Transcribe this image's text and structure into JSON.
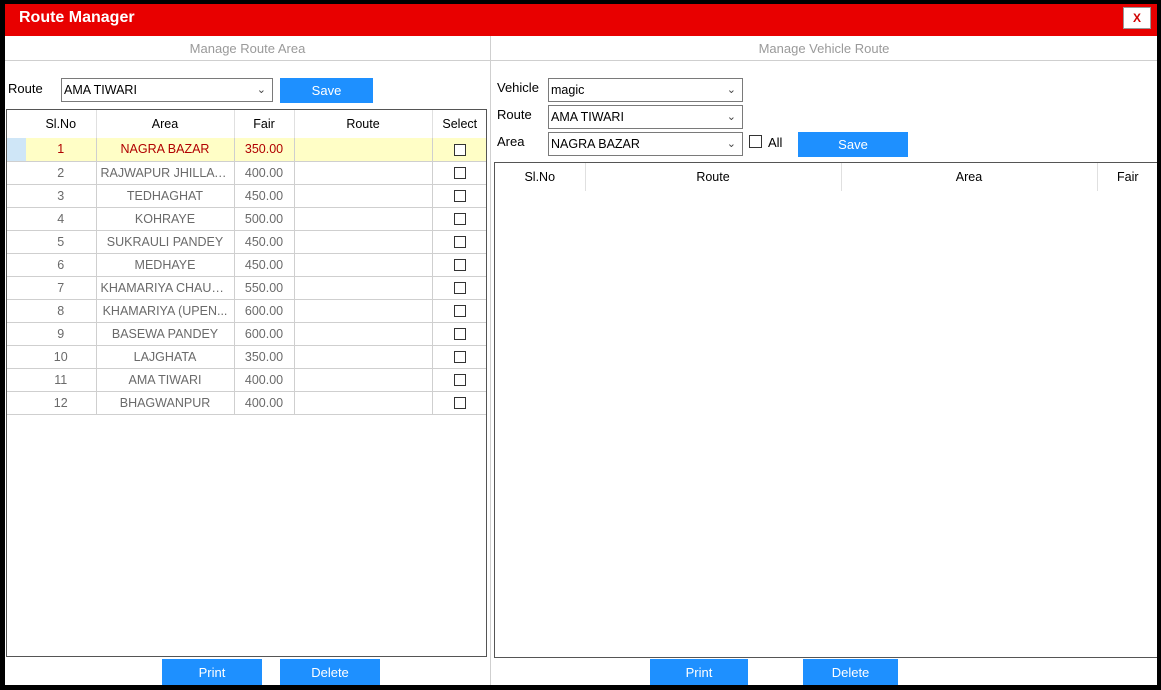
{
  "window": {
    "title": "Route Manager",
    "close_label": "X"
  },
  "left_panel": {
    "header": "Manage Route Area",
    "route_label": "Route",
    "route_value": "AMA TIWARI",
    "save_label": "Save",
    "columns": [
      "Sl.No",
      "Area",
      "Fair",
      "Route",
      "Select"
    ],
    "rows": [
      {
        "sl": "1",
        "area": "NAGRA BAZAR",
        "fair": "350.00",
        "route": ""
      },
      {
        "sl": "2",
        "area": "RAJWAPUR JHILLA C...",
        "fair": "400.00",
        "route": ""
      },
      {
        "sl": "3",
        "area": "TEDHAGHAT",
        "fair": "450.00",
        "route": ""
      },
      {
        "sl": "4",
        "area": "KOHRAYE",
        "fair": "500.00",
        "route": ""
      },
      {
        "sl": "5",
        "area": "SUKRAULI PANDEY",
        "fair": "450.00",
        "route": ""
      },
      {
        "sl": "6",
        "area": "MEDHAYE",
        "fair": "450.00",
        "route": ""
      },
      {
        "sl": "7",
        "area": "KHAMARIYA CHAUR...",
        "fair": "550.00",
        "route": ""
      },
      {
        "sl": "8",
        "area": "KHAMARIYA (UPEN...",
        "fair": "600.00",
        "route": ""
      },
      {
        "sl": "9",
        "area": "BASEWA PANDEY",
        "fair": "600.00",
        "route": ""
      },
      {
        "sl": "10",
        "area": "LAJGHATA",
        "fair": "350.00",
        "route": ""
      },
      {
        "sl": "11",
        "area": "AMA TIWARI",
        "fair": "400.00",
        "route": ""
      },
      {
        "sl": "12",
        "area": "BHAGWANPUR",
        "fair": "400.00",
        "route": ""
      }
    ],
    "print_label": "Print",
    "delete_label": "Delete"
  },
  "right_panel": {
    "header": "Manage Vehicle Route",
    "vehicle_label": "Vehicle",
    "vehicle_value": "magic",
    "route_label": "Route",
    "route_value": "AMA TIWARI",
    "area_label": "Area",
    "area_value": "NAGRA BAZAR",
    "all_label": "All",
    "save_label": "Save",
    "columns": [
      "Sl.No",
      "Route",
      "Area",
      "Fair"
    ],
    "print_label": "Print",
    "delete_label": "Delete"
  },
  "colors": {
    "title_bar": "#e80000",
    "button": "#1e90ff",
    "selected_row_bg": "#fffec6",
    "selected_row_text": "#b00000"
  }
}
